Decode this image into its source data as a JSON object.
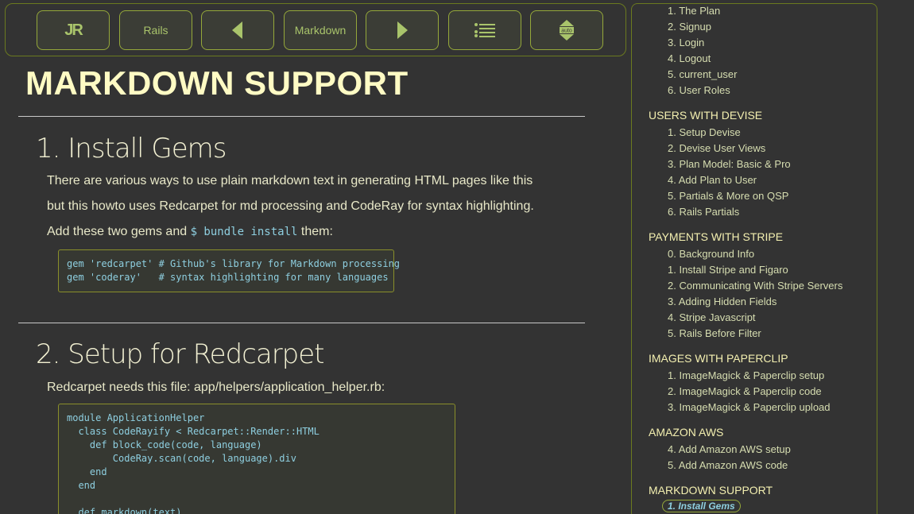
{
  "toolbar": {
    "buttons": [
      {
        "id": "logo",
        "label": "JR",
        "icon": "jr-logo-icon"
      },
      {
        "id": "rails",
        "label": "Rails"
      },
      {
        "id": "prev",
        "icon": "triangle-left-icon"
      },
      {
        "id": "markdown",
        "label": "Markdown"
      },
      {
        "id": "next",
        "icon": "triangle-right-icon"
      },
      {
        "id": "list",
        "icon": "list-settings-icon"
      },
      {
        "id": "auto",
        "label": "auto",
        "icon": "up-down-arrows-icon"
      }
    ],
    "accent": "#a9c46b",
    "border": "#6b7a1f"
  },
  "main": {
    "title": "MARKDOWN SUPPORT",
    "sections": [
      {
        "title": "1. Install Gems",
        "paragraphs": [
          "There are various ways to use plain markdown text in generating HTML pages like this",
          "but this howto uses Redcarpet for md processing and CodeRay for syntax highlighting."
        ],
        "add_prefix": "Add these two gems and",
        "add_code": "$ bundle install",
        "add_suffix": "them:",
        "code": "gem 'redcarpet' # Github's library for Markdown processing\ngem 'coderay'   # syntax highlighting for many languages"
      },
      {
        "title": "2. Setup for Redcarpet",
        "paragraph": "Redcarpet needs this file: app/helpers/application_helper.rb:",
        "code": "module ApplicationHelper\n  class CodeRayify < Redcarpet::Render::HTML\n    def block_code(code, language)\n        CodeRay.scan(code, language).div\n    end\n  end\n\n  def markdown(text)"
      }
    ]
  },
  "sidebar": {
    "top_items": [
      "1. The Plan",
      "2. Signup",
      "3. Login",
      "4. Logout",
      "5. current_user",
      "6. User Roles"
    ],
    "groups": [
      {
        "heading": "USERS WITH DEVISE",
        "items": [
          "1. Setup Devise",
          "2. Devise User Views",
          "3. Plan Model: Basic & Pro",
          "4. Add Plan to User",
          "5. Partials & More on QSP",
          "6. Rails Partials"
        ]
      },
      {
        "heading": "PAYMENTS WITH STRIPE",
        "items": [
          "0. Background Info",
          "1. Install Stripe and Figaro",
          "2. Communicating With Stripe Servers",
          "3. Adding Hidden Fields",
          "4. Stripe Javascript",
          "5. Rails Before Filter"
        ]
      },
      {
        "heading": "IMAGES WITH PAPERCLIP",
        "items": [
          "1. ImageMagick & Paperclip setup",
          "2. ImageMagick & Paperclip code",
          "3. ImageMagick & Paperclip upload"
        ]
      },
      {
        "heading": "AMAZON AWS",
        "items": [
          "4. Add Amazon AWS setup",
          "5. Add Amazon AWS code"
        ]
      },
      {
        "heading": "MARKDOWN SUPPORT",
        "items": []
      }
    ],
    "active_item": "1. Install Gems"
  }
}
